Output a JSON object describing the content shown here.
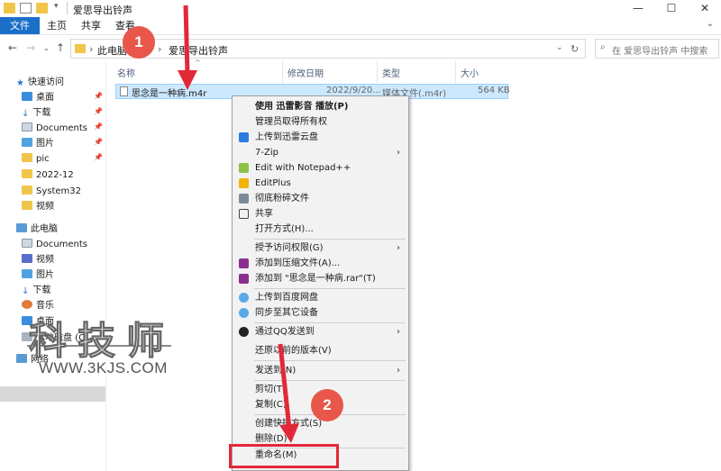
{
  "window": {
    "title": "爱思导出铃声",
    "controls": [
      "—",
      "☐",
      "✕"
    ]
  },
  "ribbon": {
    "tabs": [
      "文件",
      "主页",
      "共享",
      "查看"
    ]
  },
  "address": {
    "segments": [
      "此电脑",
      "爱思导出铃声"
    ],
    "search_placeholder": "在 爱思导出铃声 中搜索"
  },
  "nav": {
    "quick_access": "快速访问",
    "items": [
      {
        "label": "桌面",
        "icon": "desktop-icon",
        "pinned": true
      },
      {
        "label": "下载",
        "icon": "download-icon",
        "pinned": true
      },
      {
        "label": "Documents",
        "icon": "documents-icon",
        "pinned": true
      },
      {
        "label": "图片",
        "icon": "pictures-icon",
        "pinned": true
      },
      {
        "label": "pic",
        "icon": "folder-icon",
        "pinned": true
      },
      {
        "label": "2022-12",
        "icon": "folder-icon",
        "pinned": false
      },
      {
        "label": "System32",
        "icon": "folder-icon",
        "pinned": false
      },
      {
        "label": "视频",
        "icon": "folder-icon",
        "pinned": false
      }
    ],
    "this_pc": "此电脑",
    "pc_items": [
      {
        "label": "Documents",
        "icon": "documents-icon"
      },
      {
        "label": "视频",
        "icon": "videos-icon"
      },
      {
        "label": "图片",
        "icon": "pictures-icon"
      },
      {
        "label": "下载",
        "icon": "download-icon"
      },
      {
        "label": "音乐",
        "icon": "music-icon"
      },
      {
        "label": "桌面",
        "icon": "desktop-icon"
      },
      {
        "label": "本地磁盘 (C",
        "icon": "drive-icon"
      }
    ],
    "network": "网络"
  },
  "columns": [
    "名称",
    "修改日期",
    "类型",
    "大小"
  ],
  "file": {
    "name": "思念是一种病.m4r",
    "date": "2022/9/20...",
    "type": "媒体文件(.m4r)",
    "size": "564 KB"
  },
  "context_menu": [
    {
      "label": "使用 迅雷影音 播放(P)",
      "bold": true,
      "icon": ""
    },
    {
      "label": "管理员取得所有权",
      "icon": ""
    },
    {
      "label": "上传到迅雷云盘",
      "icon": "xunlei-cloud-icon"
    },
    {
      "label": "7-Zip",
      "icon": "",
      "submenu": true
    },
    {
      "label": "Edit with Notepad++",
      "icon": "notepad-plus-plus-icon"
    },
    {
      "label": "EditPlus",
      "icon": "editplus-icon"
    },
    {
      "label": "彻底粉碎文件",
      "icon": "shred-icon"
    },
    {
      "label": "共享",
      "icon": "share-icon"
    },
    {
      "label": "打开方式(H)...",
      "icon": ""
    },
    {
      "label": "授予访问权限(G)",
      "icon": "",
      "submenu": true
    },
    {
      "label": "添加到压缩文件(A)...",
      "icon": "winrar-icon"
    },
    {
      "label": "添加到 \"思念是一种病.rar\"(T)",
      "icon": "winrar-icon"
    },
    {
      "label": "上传到百度网盘",
      "icon": "baidu-cloud-icon"
    },
    {
      "label": "同步至其它设备",
      "icon": "baidu-cloud-icon"
    },
    {
      "label": "通过QQ发送到",
      "icon": "qq-icon",
      "submenu": true
    },
    {
      "label": "还原以前的版本(V)",
      "icon": ""
    },
    {
      "label": "发送到(N)",
      "icon": "",
      "submenu": true
    },
    {
      "label": "剪切(T)",
      "icon": ""
    },
    {
      "label": "复制(C)",
      "icon": ""
    },
    {
      "label": "创建快捷方式(S)",
      "icon": ""
    },
    {
      "label": "删除(D)",
      "icon": ""
    },
    {
      "label": "重命名(M)",
      "icon": ""
    }
  ],
  "annotations": {
    "step1": "1",
    "step2": "2",
    "accent": "#e8574a",
    "highlight": "#e32838"
  },
  "watermark": {
    "chars": [
      "科",
      "技",
      "师"
    ],
    "url": "WWW.3KJS.COM"
  },
  "colors": {
    "file_tab": "#1a6fc9",
    "selection": "#cce8ff"
  }
}
